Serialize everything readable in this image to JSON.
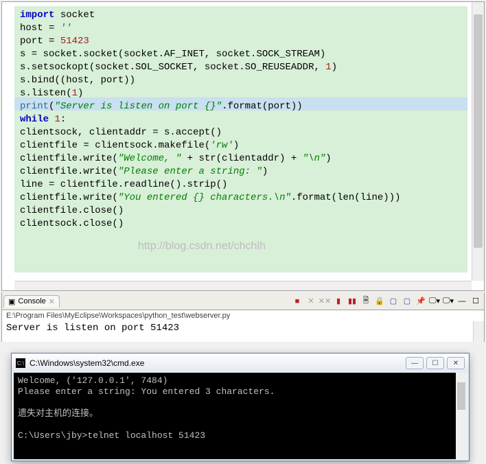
{
  "code": {
    "lines": [
      {
        "t": "import",
        "k": "kw"
      },
      {
        "t": " socket"
      },
      null,
      {
        "t": "host = "
      },
      {
        "t": "''",
        "k": "str"
      },
      null,
      {
        "t": "port = "
      },
      {
        "t": "51423",
        "k": "num"
      },
      null,
      null,
      {
        "t": "s = socket.socket(socket.AF_INET, socket.SOCK_STREAM)"
      },
      null,
      {
        "t": "s.setsockopt(socket.SOL_SOCKET, socket.SO_REUSEADDR, "
      },
      {
        "t": "1",
        "k": "num"
      },
      {
        "t": ")"
      },
      null,
      {
        "t": "s.bind((host, port))"
      },
      null,
      {
        "t": "s.listen("
      },
      {
        "t": "1",
        "k": "num"
      },
      {
        "t": ")"
      },
      null,
      null,
      {
        "t": "print",
        "k": "fn"
      },
      {
        "t": "("
      },
      {
        "t": "\"Server is listen on port {}\"",
        "k": "str"
      },
      {
        "t": ".format(port))"
      },
      null,
      {
        "t": "while",
        "k": "kw"
      },
      {
        "t": " "
      },
      {
        "t": "1",
        "k": "num"
      },
      {
        "t": ":"
      },
      null,
      {
        "t": "    clientsock, clientaddr = s.accept()"
      },
      null,
      {
        "t": "    clientfile = clientsock.makefile("
      },
      {
        "t": "'rw'",
        "k": "str"
      },
      {
        "t": ")"
      },
      null,
      {
        "t": "    clientfile.write("
      },
      {
        "t": "\"Welcome, \"",
        "k": "str"
      },
      {
        "t": " + str(clientaddr) + "
      },
      {
        "t": "\"\\n\"",
        "k": "str"
      },
      {
        "t": ")"
      },
      null,
      {
        "t": "    clientfile.write("
      },
      {
        "t": "\"Please enter a string: \"",
        "k": "str"
      },
      {
        "t": ")"
      },
      null,
      {
        "t": "    line = clientfile.readline().strip()"
      },
      null,
      {
        "t": "    clientfile.write("
      },
      {
        "t": "\"You entered {} characters.\\n\"",
        "k": "str"
      },
      {
        "t": ".format(len(line)))"
      },
      null,
      {
        "t": "    clientfile.close()"
      },
      null,
      {
        "t": "    clientsock.close()"
      }
    ],
    "highlight_line_index": 7
  },
  "watermark": "http://blog.csdn.net/chchlh",
  "console": {
    "tab_label": "Console",
    "path": "E:\\Program Files\\MyEclipse\\Workspaces\\python_test\\webserver.py",
    "output": "Server is listen on port 51423"
  },
  "cmd": {
    "title": "C:\\Windows\\system32\\cmd.exe",
    "lines": [
      "  Welcome, ('127.0.0.1', 7484)",
      "Please enter a string: You entered 3 characters.",
      "",
      "遗失对主机的连接。",
      "",
      "C:\\Users\\jby>telnet localhost 51423"
    ]
  },
  "icons": {
    "close": "✕",
    "stop": "■",
    "gear": "⚙",
    "refresh": "↻",
    "pin": "📌",
    "arrow": "▾",
    "min": "—",
    "max": "☐"
  }
}
